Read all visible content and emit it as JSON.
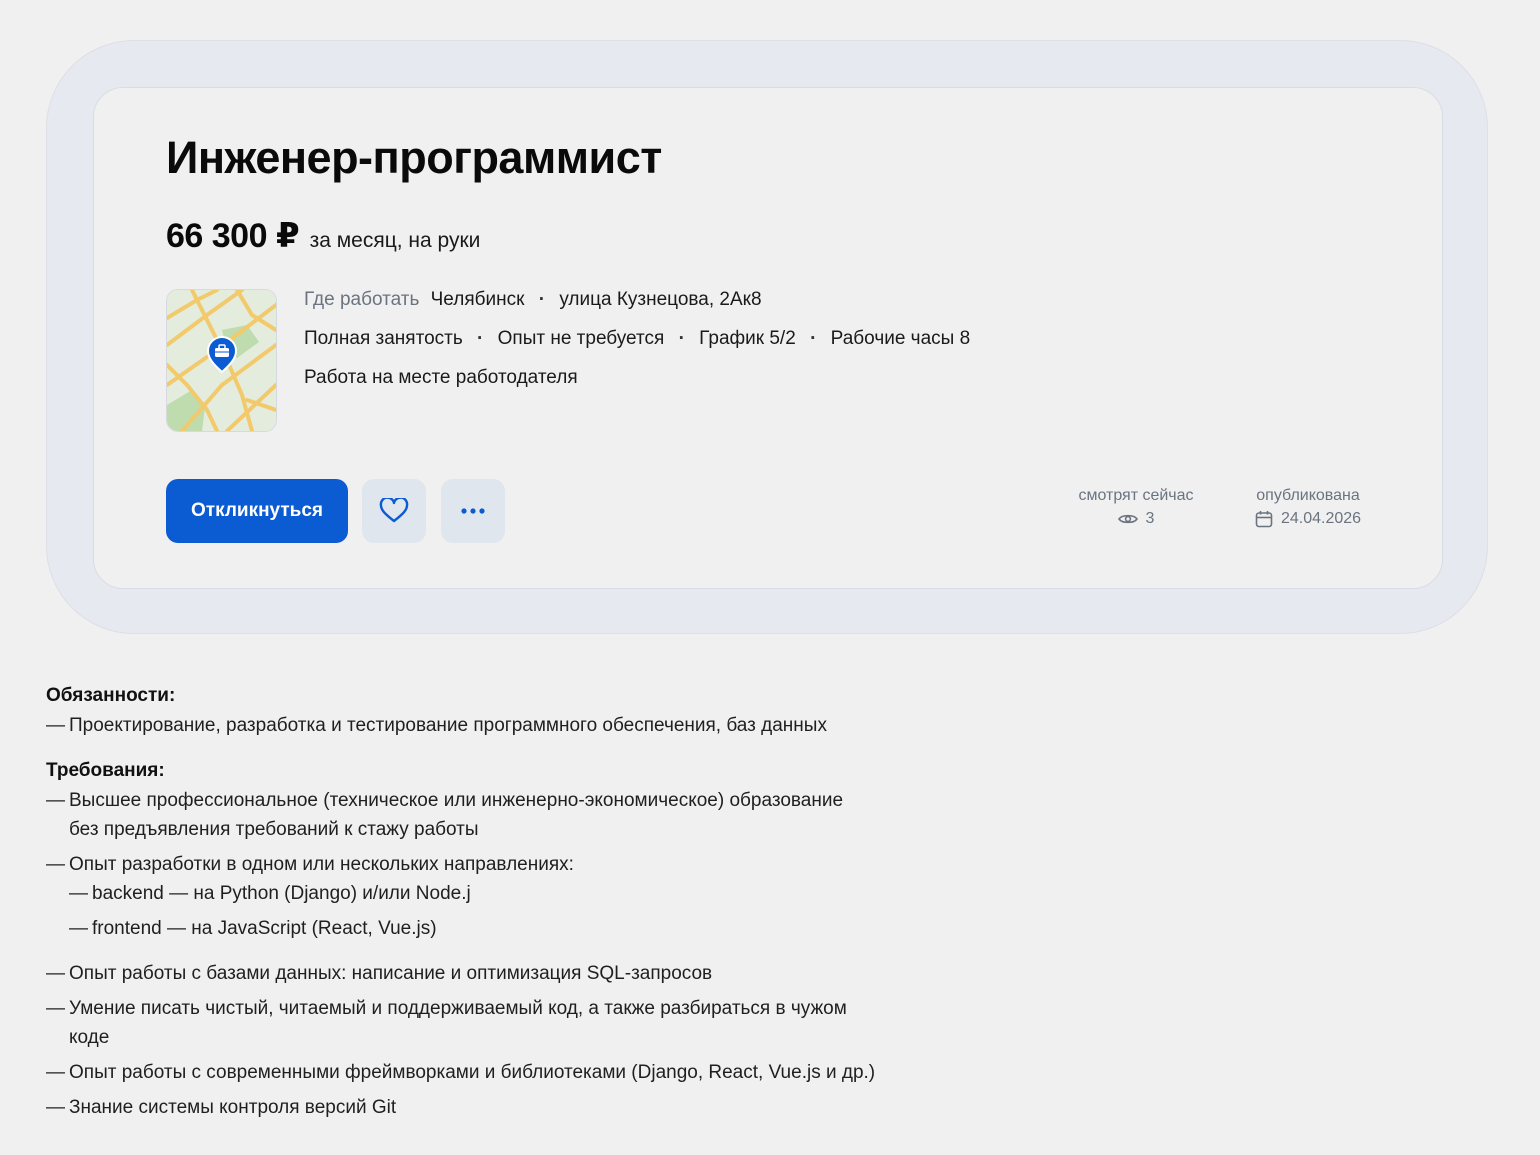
{
  "vacancy": {
    "title": "Инженер-программист",
    "salary_amount": "66 300 ₽",
    "salary_note": "за месяц, на руки",
    "location_label": "Где работать",
    "city": "Челябинск",
    "address": "улица Кузнецова, 2Ак8",
    "employment": "Полная занятость",
    "experience": "Опыт не требуется",
    "schedule": "График 5/2",
    "hours": "Рабочие часы 8",
    "work_format": "Работа на месте работодателя"
  },
  "actions": {
    "apply_label": "Откликнуться",
    "favorite_icon": "heart-icon",
    "more_icon": "ellipsis-icon"
  },
  "meta": {
    "views_label": "смотрят сейчас",
    "views_value": "3",
    "published_label": "опубликована",
    "published_value": "24.04.2026"
  },
  "description": {
    "dash": "—",
    "duties_heading": "Обязанности:",
    "duties": [
      "Проектирование, разработка и тестирование программного обеспечения, баз данных"
    ],
    "requirements_heading": "Требования:",
    "requirements": [
      "Высшее профессиональное (техническое или инженерно-экономическое) образование",
      "без предъявления требований к стажу работы",
      "Опыт разработки в одном или нескольких направлениях:",
      "backend — на Python (Django) и/или Node.j",
      "frontend — на JavaScript (React, Vue.js)",
      "Опыт работы с базами данных: написание и оптимизация SQL-запросов",
      "Умение писать чистый, читаемый и поддерживаемый код, а также разбираться в чужом",
      "коде",
      "Опыт работы с современными фреймворками и библиотеками (Django, React, Vue.js и др.)",
      "Знание системы контроля версий Git"
    ]
  },
  "colors": {
    "accent": "#0b5bd3",
    "background": "#f0f0f0",
    "frame": "#e6e9ef",
    "icon_button": "#dfe6ee",
    "muted_text": "#6a7480"
  }
}
